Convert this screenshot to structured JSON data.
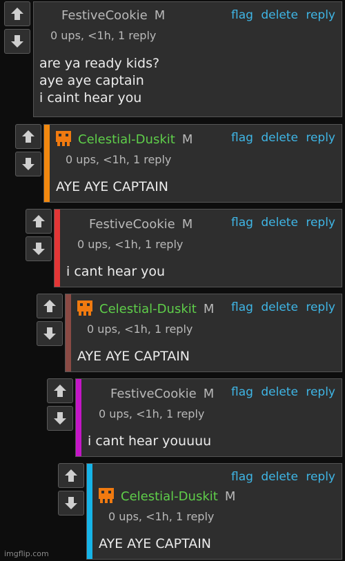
{
  "icons": {
    "upvote": "arrow-up-icon",
    "downvote": "arrow-down-icon",
    "avatar": "orange-pixel-avatar-icon"
  },
  "colors": {
    "link": "#3fb6e6",
    "green_user": "#5fcf4a",
    "stripe_orange": "#f2880f",
    "stripe_red": "#e33636",
    "stripe_brown": "#8a4a44",
    "stripe_magenta": "#c416c7",
    "stripe_cyan": "#16b4e8",
    "avatar": "#f07a10"
  },
  "comments": [
    {
      "username": "FestiveCookie",
      "badge": "M",
      "meta": "0 ups, <1h, 1 reply",
      "text": "are ya ready kids?\naye aye captain\ni caint hear you",
      "actions": {
        "flag": "flag",
        "delete": "delete",
        "reply": "reply"
      }
    },
    {
      "username": "Celestial-Duskit",
      "badge": "M",
      "meta": "0 ups, <1h, 1 reply",
      "text": "AYE AYE CAPTAIN",
      "actions": {
        "flag": "flag",
        "delete": "delete",
        "reply": "reply"
      }
    },
    {
      "username": "FestiveCookie",
      "badge": "M",
      "meta": "0 ups, <1h, 1 reply",
      "text": "i cant hear you",
      "actions": {
        "flag": "flag",
        "delete": "delete",
        "reply": "reply"
      }
    },
    {
      "username": "Celestial-Duskit",
      "badge": "M",
      "meta": "0 ups, <1h, 1 reply",
      "text": "AYE AYE CAPTAIN",
      "actions": {
        "flag": "flag",
        "delete": "delete",
        "reply": "reply"
      }
    },
    {
      "username": "FestiveCookie",
      "badge": "M",
      "meta": "0 ups, <1h, 1 reply",
      "text": "i cant hear youuuu",
      "actions": {
        "flag": "flag",
        "delete": "delete",
        "reply": "reply"
      }
    },
    {
      "username": "Celestial-Duskit",
      "badge": "M",
      "meta": "0 ups, <1h, 1 reply",
      "text": "AYE AYE CAPTAIN",
      "actions": {
        "flag": "flag",
        "delete": "delete",
        "reply": "reply"
      }
    }
  ],
  "watermark": "imgflip.com"
}
